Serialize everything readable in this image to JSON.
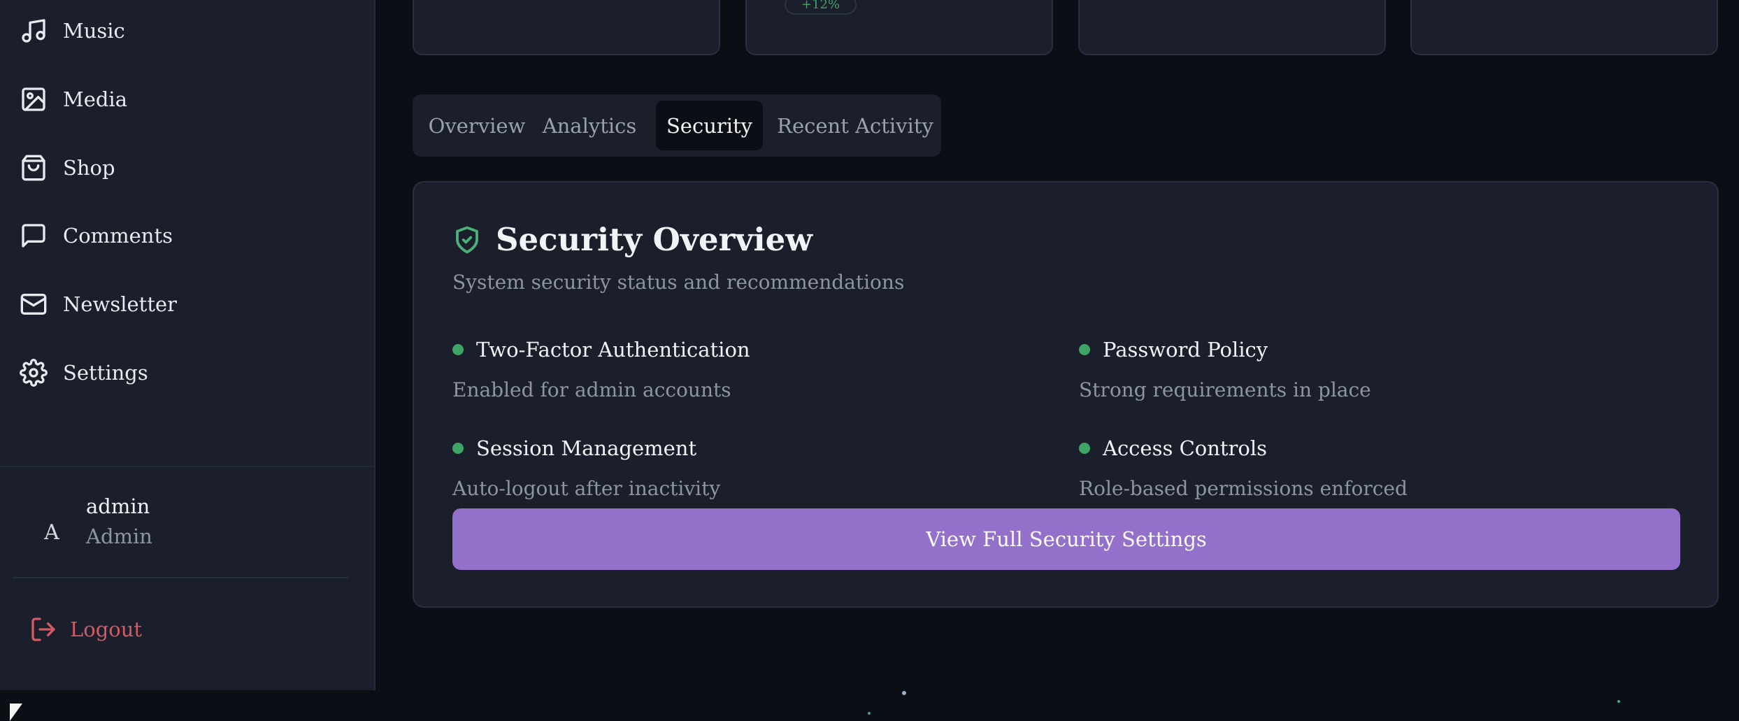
{
  "sidebar": {
    "items": [
      {
        "label": "Music",
        "icon": "music-icon"
      },
      {
        "label": "Media",
        "icon": "image-icon"
      },
      {
        "label": "Shop",
        "icon": "shopping-bag-icon"
      },
      {
        "label": "Comments",
        "icon": "message-square-icon"
      },
      {
        "label": "Newsletter",
        "icon": "mail-icon"
      },
      {
        "label": "Settings",
        "icon": "gear-icon"
      }
    ],
    "user": {
      "initial": "A",
      "name": "admin",
      "role": "Admin"
    },
    "logout_label": "Logout"
  },
  "stats": {
    "change_badge": "+12%"
  },
  "tabs": [
    {
      "label": "Overview"
    },
    {
      "label": "Analytics"
    },
    {
      "label": "Security",
      "active": true
    },
    {
      "label": "Recent Activity"
    }
  ],
  "security": {
    "title": "Security Overview",
    "subtitle": "System security status and recommendations",
    "features": [
      {
        "name": "Two-Factor Authentication",
        "desc": "Enabled for admin accounts"
      },
      {
        "name": "Password Policy",
        "desc": "Strong requirements in place"
      },
      {
        "name": "Session Management",
        "desc": "Auto-logout after inactivity"
      },
      {
        "name": "Access Controls",
        "desc": "Role-based permissions enforced"
      }
    ],
    "cta_label": "View Full Security Settings"
  },
  "colors": {
    "background": "#0b0e15",
    "panel": "#1a1f2b",
    "accent": "#9370c9",
    "success": "#3fa567",
    "danger": "#d35a64"
  }
}
